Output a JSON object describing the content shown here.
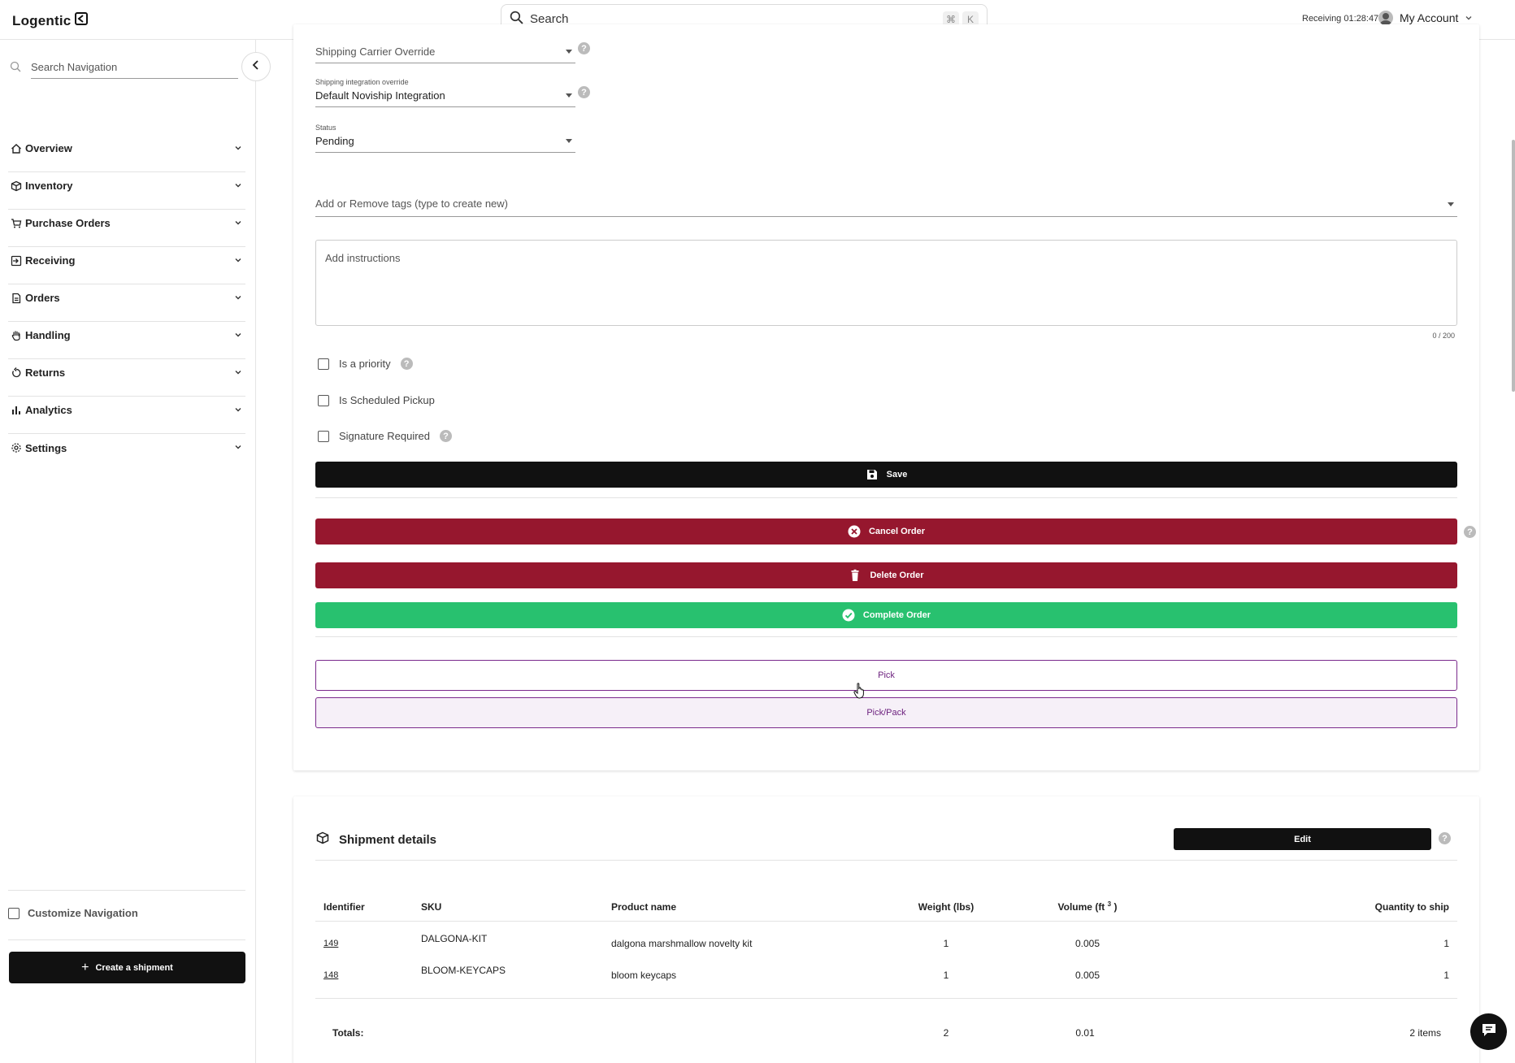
{
  "app": {
    "logo_text": "Logentic",
    "search_placeholder": "Search",
    "search_shortcut": [
      "⌘",
      "K"
    ],
    "receiving_label": "Receiving 01:28:47",
    "account_label": "My Account"
  },
  "sidebar": {
    "search_placeholder": "Search Navigation",
    "items": [
      {
        "label": "Overview",
        "icon": "home-icon"
      },
      {
        "label": "Inventory",
        "icon": "box-icon"
      },
      {
        "label": "Purchase Orders",
        "icon": "cart-icon"
      },
      {
        "label": "Receiving",
        "icon": "receiving-icon"
      },
      {
        "label": "Orders",
        "icon": "document-icon"
      },
      {
        "label": "Handling",
        "icon": "hand-icon"
      },
      {
        "label": "Returns",
        "icon": "return-icon"
      },
      {
        "label": "Analytics",
        "icon": "bar-chart-icon"
      },
      {
        "label": "Settings",
        "icon": "gear-icon"
      }
    ],
    "customize_label": "Customize Navigation",
    "create_shipment_label": "Create a shipment"
  },
  "order_form": {
    "carrier_override": {
      "value": "Shipping Carrier Override"
    },
    "integration_override": {
      "label": "Shipping integration override",
      "value": "Default Noviship Integration"
    },
    "status": {
      "label": "Status",
      "value": "Pending"
    },
    "tags_placeholder": "Add or Remove tags (type to create new)",
    "instructions_placeholder": "Add instructions",
    "instructions_counter": "0 / 200",
    "checkboxes": {
      "priority": "Is a priority",
      "scheduled_pickup": "Is Scheduled Pickup",
      "signature": "Signature Required"
    },
    "buttons": {
      "save": "Save",
      "cancel": "Cancel Order",
      "delete": "Delete Order",
      "complete": "Complete Order",
      "pick": "Pick",
      "pick_pack": "Pick/Pack"
    },
    "colors": {
      "danger": "#96172e",
      "success": "#28c16f",
      "primary": "#111111",
      "accent": "#6b1f7d"
    }
  },
  "shipment": {
    "title": "Shipment details",
    "edit_label": "Edit",
    "columns": {
      "identifier": "Identifier",
      "sku": "SKU",
      "product_name": "Product name",
      "weight": "Weight (lbs)",
      "volume": "Volume (ft",
      "volume_exp": "3",
      "volume_close": ")",
      "quantity": "Quantity to ship"
    },
    "rows": [
      {
        "id": "149",
        "sku": "DALGONA-KIT",
        "name": "dalgona marshmallow novelty kit",
        "weight": "1",
        "volume": "0.005",
        "qty": "1"
      },
      {
        "id": "148",
        "sku": "BLOOM-KEYCAPS",
        "name": "bloom keycaps",
        "weight": "1",
        "volume": "0.005",
        "qty": "1"
      }
    ],
    "totals": {
      "label": "Totals:",
      "weight": "2",
      "volume": "0.01",
      "qty": "2 items"
    }
  }
}
